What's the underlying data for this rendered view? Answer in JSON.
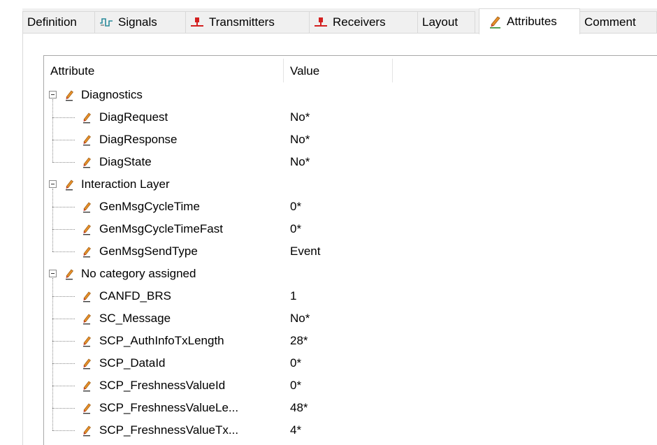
{
  "tabs": [
    {
      "label": "Definition",
      "icon": "none",
      "active": false
    },
    {
      "label": "Signals",
      "icon": "signals-icon",
      "active": false
    },
    {
      "label": "Transmitters",
      "icon": "transmitter-icon",
      "active": false
    },
    {
      "label": "Receivers",
      "icon": "receiver-icon",
      "active": false
    },
    {
      "label": "Layout",
      "icon": "none",
      "active": false
    },
    {
      "label": "Attributes",
      "icon": "attribute-pencil-icon",
      "active": true
    },
    {
      "label": "Comment",
      "icon": "none",
      "active": false
    }
  ],
  "table": {
    "headers": [
      "Attribute",
      "Value"
    ]
  },
  "groups": [
    {
      "label": "Diagnostics",
      "items": [
        {
          "name": "DiagRequest",
          "value": "No*"
        },
        {
          "name": "DiagResponse",
          "value": "No*"
        },
        {
          "name": "DiagState",
          "value": "No*"
        }
      ]
    },
    {
      "label": "Interaction Layer",
      "items": [
        {
          "name": "GenMsgCycleTime",
          "value": "0*"
        },
        {
          "name": "GenMsgCycleTimeFast",
          "value": "0*"
        },
        {
          "name": "GenMsgSendType",
          "value": "Event"
        }
      ]
    },
    {
      "label": "No category assigned",
      "items": [
        {
          "name": "CANFD_BRS",
          "value": "1"
        },
        {
          "name": "SC_Message",
          "value": "No*"
        },
        {
          "name": "SCP_AuthInfoTxLength",
          "value": "28*"
        },
        {
          "name": "SCP_DataId",
          "value": "0*"
        },
        {
          "name": "SCP_FreshnessValueId",
          "value": "0*"
        },
        {
          "name": "SCP_FreshnessValueLe...",
          "value": "48*"
        },
        {
          "name": "SCP_FreshnessValueTx...",
          "value": "4*"
        }
      ]
    }
  ],
  "colors": {
    "pencil_body": "#e8902a",
    "pencil_lead": "#c0392b",
    "transmitter_red": "#d32020",
    "signals_teal": "#2a8a9a"
  }
}
